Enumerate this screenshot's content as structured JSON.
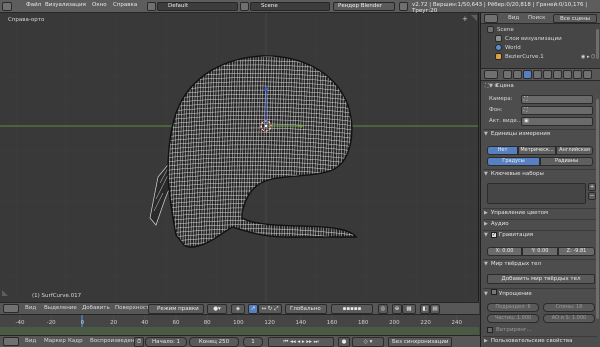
{
  "topbar": {
    "menus": [
      "Файл",
      "Визуализация",
      "Окно",
      "Справка"
    ],
    "screen_layout": "Default",
    "scene": "Scene",
    "engine": "Рендер Blender",
    "stats": "v2.72 | Вершин:1/50,643 | Рёбер:0/20,818 | Граней:0/10,176 | Треуг:20"
  },
  "viewport": {
    "view_label": "Справа-орто",
    "object_label": "(1) SurfCurve.017"
  },
  "vheader": {
    "items": [
      "Вид",
      "Выделение",
      "Добавить",
      "Поверхность"
    ],
    "mode": "Режим правки",
    "orientation": "Глобально"
  },
  "timeline": {
    "ticks": [
      "-40",
      "-20",
      "0",
      "20",
      "40",
      "60",
      "80",
      "100",
      "120",
      "140",
      "160",
      "180",
      "200",
      "220",
      "240",
      "260"
    ],
    "menus": [
      "Вид",
      "Маркер",
      "Кадр",
      "Воспроизведение"
    ],
    "start_label": "Начало:",
    "start_value": "1",
    "end_label": "Конец",
    "end_value": "250",
    "current": "1",
    "sync": "Без синхронизации"
  },
  "outliner": {
    "view": "Вид",
    "search": "Поиск",
    "filter": "Все сцены",
    "items": [
      "Scene",
      "Слои визуализации",
      "World",
      "BezierCurve.1"
    ]
  },
  "properties": {
    "scene_header": "Сцена",
    "camera_label": "Камера:",
    "background_label": "Фон:",
    "active_label": "Акт. виде...",
    "units_header": "Единицы измерения",
    "units": [
      "Нет",
      "Метрическ...",
      "Английская"
    ],
    "angles": [
      "Градусы",
      "Радианы"
    ],
    "keyingsets_header": "Ключевые наборы",
    "color_header": "Управление цветом",
    "audio_header": "Аудио",
    "gravity_header": "Гравитация",
    "gravity": {
      "x": "X: 0.00",
      "y": "Y: 0.00",
      "z": "Z: -9.81"
    },
    "rigid_header": "Мир твёрдых тел",
    "rigid_button": "Добавить мир твёрдых тел",
    "simplify_header": "Упрощение",
    "simplify_fields": [
      "Подраздел: 6",
      "Спины: 16",
      "Частиц: 1.000",
      "AO и S: 1.000"
    ],
    "raytrace": "Ветрирянг...",
    "custom_header": "Пользовательские свойства"
  },
  "colors": {
    "accent": "#5680c2",
    "mesh": "#ffffff",
    "grid_green": "#6fa83c",
    "axis_blue": "#3b5be0",
    "playhead": "#4c8fd9"
  }
}
